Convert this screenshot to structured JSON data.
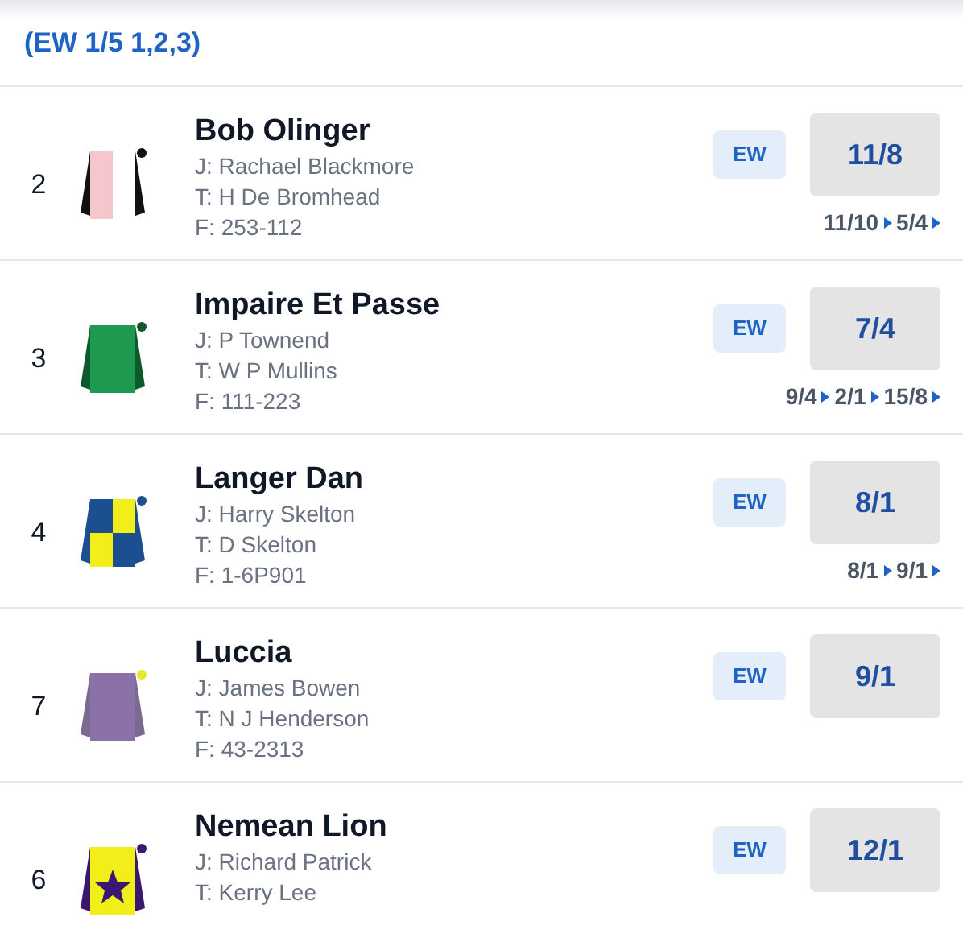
{
  "terms": "(EW 1/5 1,2,3)",
  "runners": [
    {
      "number": "2",
      "name": "Bob Olinger",
      "jockey": "J: Rachael Blackmore",
      "trainer": "T: H De Bromhead",
      "form": "F: 253-112",
      "ew": "EW",
      "odds": "11/8",
      "history": [
        "11/10",
        "5/4"
      ]
    },
    {
      "number": "3",
      "name": "Impaire Et Passe",
      "jockey": "J: P Townend",
      "trainer": "T: W P Mullins",
      "form": "F: 111-223",
      "ew": "EW",
      "odds": "7/4",
      "history": [
        "9/4",
        "2/1",
        "15/8"
      ]
    },
    {
      "number": "4",
      "name": "Langer Dan",
      "jockey": "J: Harry Skelton",
      "trainer": "T: D Skelton",
      "form": "F: 1-6P901",
      "ew": "EW",
      "odds": "8/1",
      "history": [
        "8/1",
        "9/1"
      ]
    },
    {
      "number": "7",
      "name": "Luccia",
      "jockey": "J: James Bowen",
      "trainer": "T: N J Henderson",
      "form": "F: 43-2313",
      "ew": "EW",
      "odds": "9/1"
    },
    {
      "number": "6",
      "name": "Nemean Lion",
      "jockey": "J: Richard Patrick",
      "trainer": "T: Kerry Lee",
      "ew": "EW",
      "odds": "12/1"
    }
  ]
}
